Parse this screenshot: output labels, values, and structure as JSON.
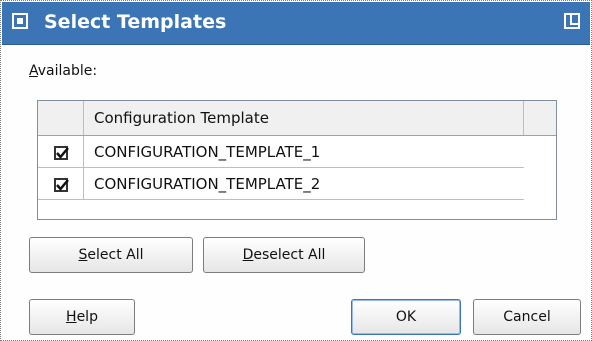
{
  "dialog": {
    "title": "Select Templates",
    "available_label_rest": "vailable:",
    "available_label_mnemonic": "A"
  },
  "table": {
    "header": "Configuration Template",
    "rows": [
      {
        "checked": true,
        "name": "CONFIGURATION_TEMPLATE_1"
      },
      {
        "checked": true,
        "name": "CONFIGURATION_TEMPLATE_2"
      }
    ]
  },
  "buttons": {
    "select_all": {
      "mnemonic": "S",
      "rest": "elect All"
    },
    "deselect_all": {
      "mnemonic": "D",
      "rest": "eselect All"
    },
    "help": {
      "mnemonic": "H",
      "rest": "elp"
    },
    "ok": "OK",
    "cancel": "Cancel"
  },
  "colors": {
    "titlebar": "#3b75b6",
    "title_text": "#ffffff"
  },
  "icons": {
    "window_menu": "window-menu-icon",
    "maximize": "maximize-icon",
    "checkbox_checked": "checkbox-checked-icon"
  }
}
